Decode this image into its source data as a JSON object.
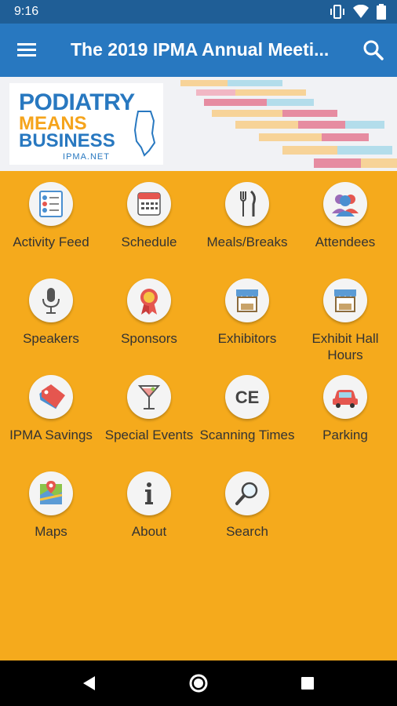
{
  "status_bar": {
    "time": "9:16"
  },
  "app_bar": {
    "title": "The 2019 IPMA Annual Meeti..."
  },
  "banner": {
    "logo_line1": "PODIATRY",
    "logo_line2": "MEANS",
    "logo_line3": "BUSINESS",
    "logo_url": "IPMA.NET"
  },
  "tiles": [
    {
      "label": "Activity Feed",
      "icon": "activity-feed-icon"
    },
    {
      "label": "Schedule",
      "icon": "calendar-icon"
    },
    {
      "label": "Meals/Breaks",
      "icon": "fork-knife-icon"
    },
    {
      "label": "Attendees",
      "icon": "people-icon"
    },
    {
      "label": "Speakers",
      "icon": "microphone-icon"
    },
    {
      "label": "Sponsors",
      "icon": "ribbon-icon"
    },
    {
      "label": "Exhibitors",
      "icon": "booth-icon"
    },
    {
      "label": "Exhibit Hall Hours",
      "icon": "booth-icon"
    },
    {
      "label": "IPMA Savings",
      "icon": "tag-icon"
    },
    {
      "label": "Special Events",
      "icon": "cocktail-icon"
    },
    {
      "label": "Scanning Times",
      "icon": "ce-icon"
    },
    {
      "label": "Parking",
      "icon": "car-icon"
    },
    {
      "label": "Maps",
      "icon": "map-icon"
    },
    {
      "label": "About",
      "icon": "info-icon"
    },
    {
      "label": "Search",
      "icon": "magnifier-icon"
    }
  ],
  "colors": {
    "status_bar": "#1F5E96",
    "app_bar": "#2878C0",
    "background": "#F5AA1C"
  }
}
